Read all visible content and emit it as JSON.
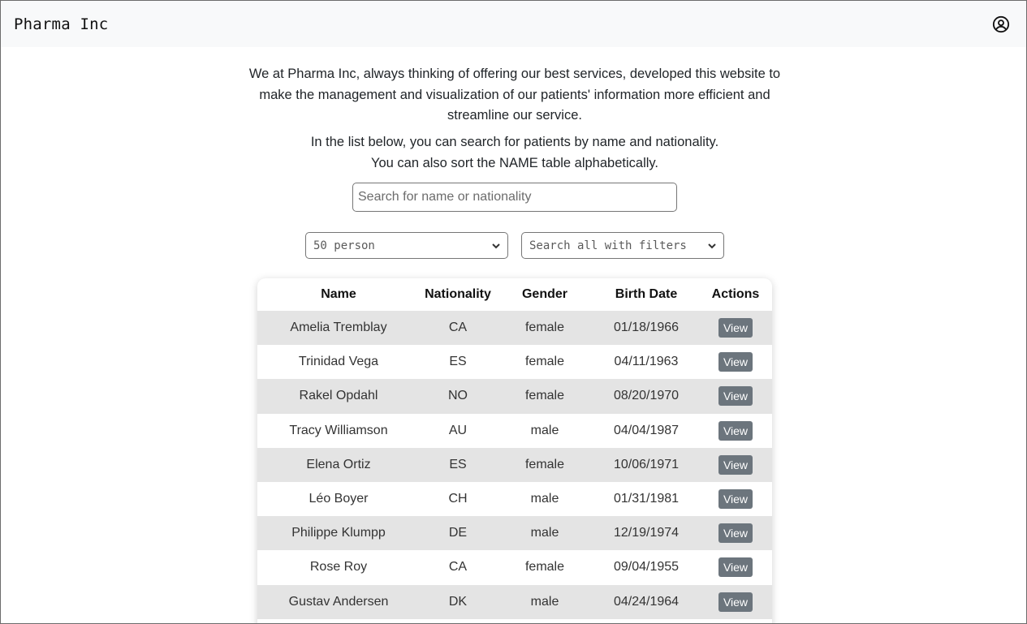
{
  "navbar": {
    "brand": "Pharma Inc",
    "user_icon": "user-circle-icon"
  },
  "intro": {
    "paragraph1": "We at Pharma Inc, always thinking of offering our best services, developed this website to make the management and visualization of our patients' information more efficient and streamline our service.",
    "paragraph2_line1": "In the list below, you can search for patients by name and nationality.",
    "paragraph2_line2": "You can also sort the NAME table alphabetically."
  },
  "search": {
    "placeholder": "Search for name or nationality",
    "value": ""
  },
  "filters": {
    "page_size_selected": "50 person",
    "filter_selected": "Search all with filters"
  },
  "table": {
    "headers": [
      "Name",
      "Nationality",
      "Gender",
      "Birth Date",
      "Actions"
    ],
    "action_label": "View",
    "rows": [
      {
        "name": "Amelia Tremblay",
        "nationality": "CA",
        "gender": "female",
        "birth": "01/18/1966"
      },
      {
        "name": "Trinidad Vega",
        "nationality": "ES",
        "gender": "female",
        "birth": "04/11/1963"
      },
      {
        "name": "Rakel Opdahl",
        "nationality": "NO",
        "gender": "female",
        "birth": "08/20/1970"
      },
      {
        "name": "Tracy Williamson",
        "nationality": "AU",
        "gender": "male",
        "birth": "04/04/1987"
      },
      {
        "name": "Elena Ortiz",
        "nationality": "ES",
        "gender": "female",
        "birth": "10/06/1971"
      },
      {
        "name": "Léo Boyer",
        "nationality": "CH",
        "gender": "male",
        "birth": "01/31/1981"
      },
      {
        "name": "Philippe Klumpp",
        "nationality": "DE",
        "gender": "male",
        "birth": "12/19/1974"
      },
      {
        "name": "Rose Roy",
        "nationality": "CA",
        "gender": "female",
        "birth": "09/04/1955"
      },
      {
        "name": "Gustav Andersen",
        "nationality": "DK",
        "gender": "male",
        "birth": "04/24/1964"
      }
    ]
  },
  "colors": {
    "navbar_bg": "#f8f9fa",
    "row_striped": "#e4e4e4",
    "button_bg": "#6c757d"
  }
}
